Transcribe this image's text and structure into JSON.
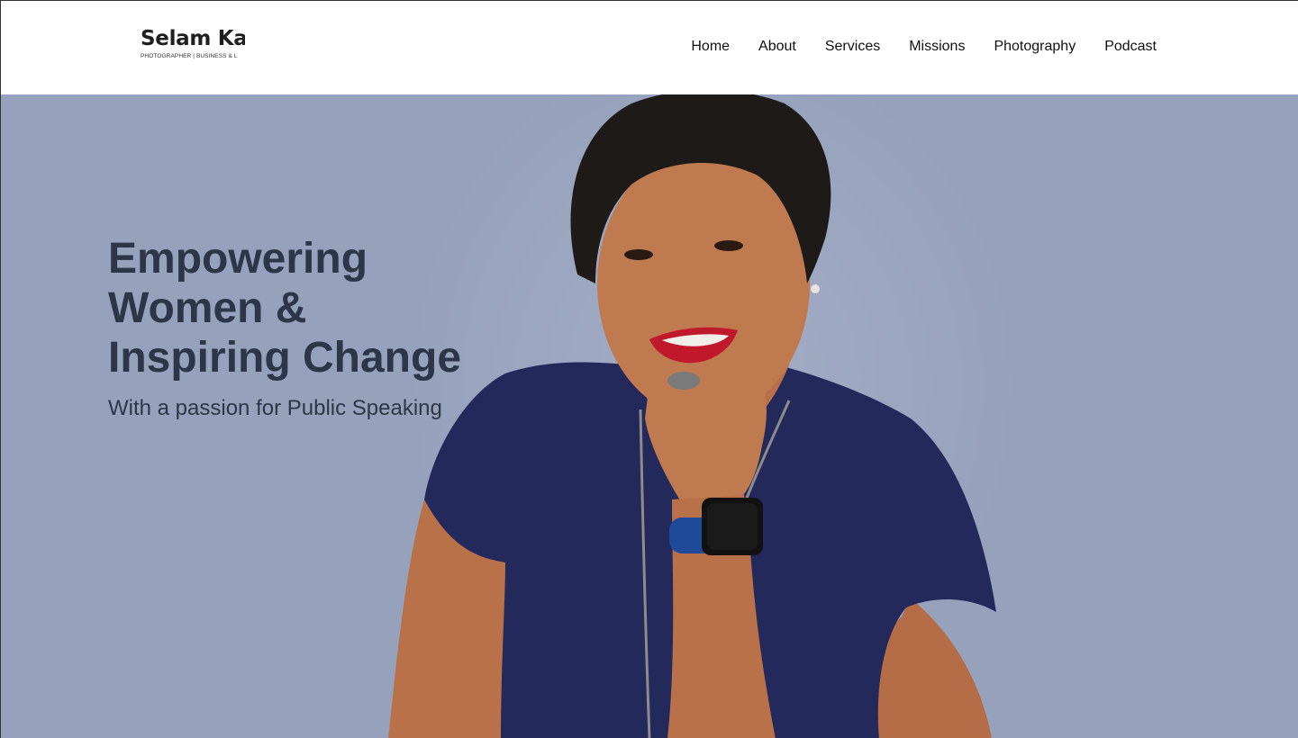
{
  "brand": {
    "name": "Selam Ka",
    "tagline": "PHOTOGRAPHER | BUSINESS & L"
  },
  "nav": {
    "items": [
      {
        "label": "Home"
      },
      {
        "label": "About"
      },
      {
        "label": "Services"
      },
      {
        "label": "Missions"
      },
      {
        "label": "Photography"
      },
      {
        "label": "Podcast"
      }
    ]
  },
  "hero": {
    "title_lines": [
      "Empowering",
      "Women &",
      "Inspiring Change"
    ],
    "subtitle": "With a passion for Public Speaking",
    "image_alt": "Portrait of smiling woman in navy top resting chin on hand",
    "background_color": "#96a1bc",
    "text_color": "#2d3648"
  }
}
